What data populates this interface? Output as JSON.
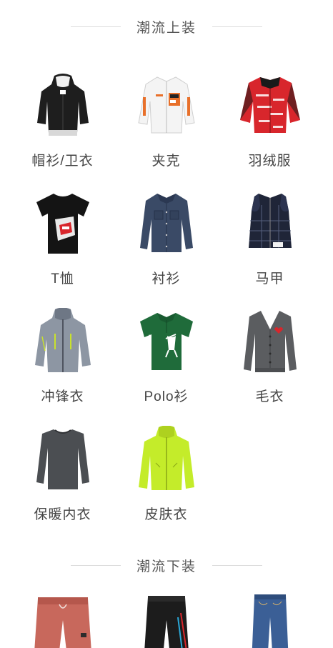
{
  "sections": {
    "tops": {
      "title": "潮流上装",
      "items": [
        {
          "label": "帽衫/卫衣",
          "icon": "hoodie-icon"
        },
        {
          "label": "夹克",
          "icon": "jacket-icon"
        },
        {
          "label": "羽绒服",
          "icon": "down-jacket-icon"
        },
        {
          "label": "T恤",
          "icon": "tshirt-icon"
        },
        {
          "label": "衬衫",
          "icon": "shirt-icon"
        },
        {
          "label": "马甲",
          "icon": "vest-icon"
        },
        {
          "label": "冲锋衣",
          "icon": "windbreaker-icon"
        },
        {
          "label": "Polo衫",
          "icon": "polo-icon"
        },
        {
          "label": "毛衣",
          "icon": "sweater-icon"
        },
        {
          "label": "保暖内衣",
          "icon": "thermal-underwear-icon"
        },
        {
          "label": "皮肤衣",
          "icon": "skin-jacket-icon"
        }
      ]
    },
    "bottoms": {
      "title": "潮流下装",
      "items": [
        {
          "icon": "jogger-pants-icon"
        },
        {
          "icon": "track-pants-icon"
        },
        {
          "icon": "jeans-icon"
        }
      ]
    }
  }
}
